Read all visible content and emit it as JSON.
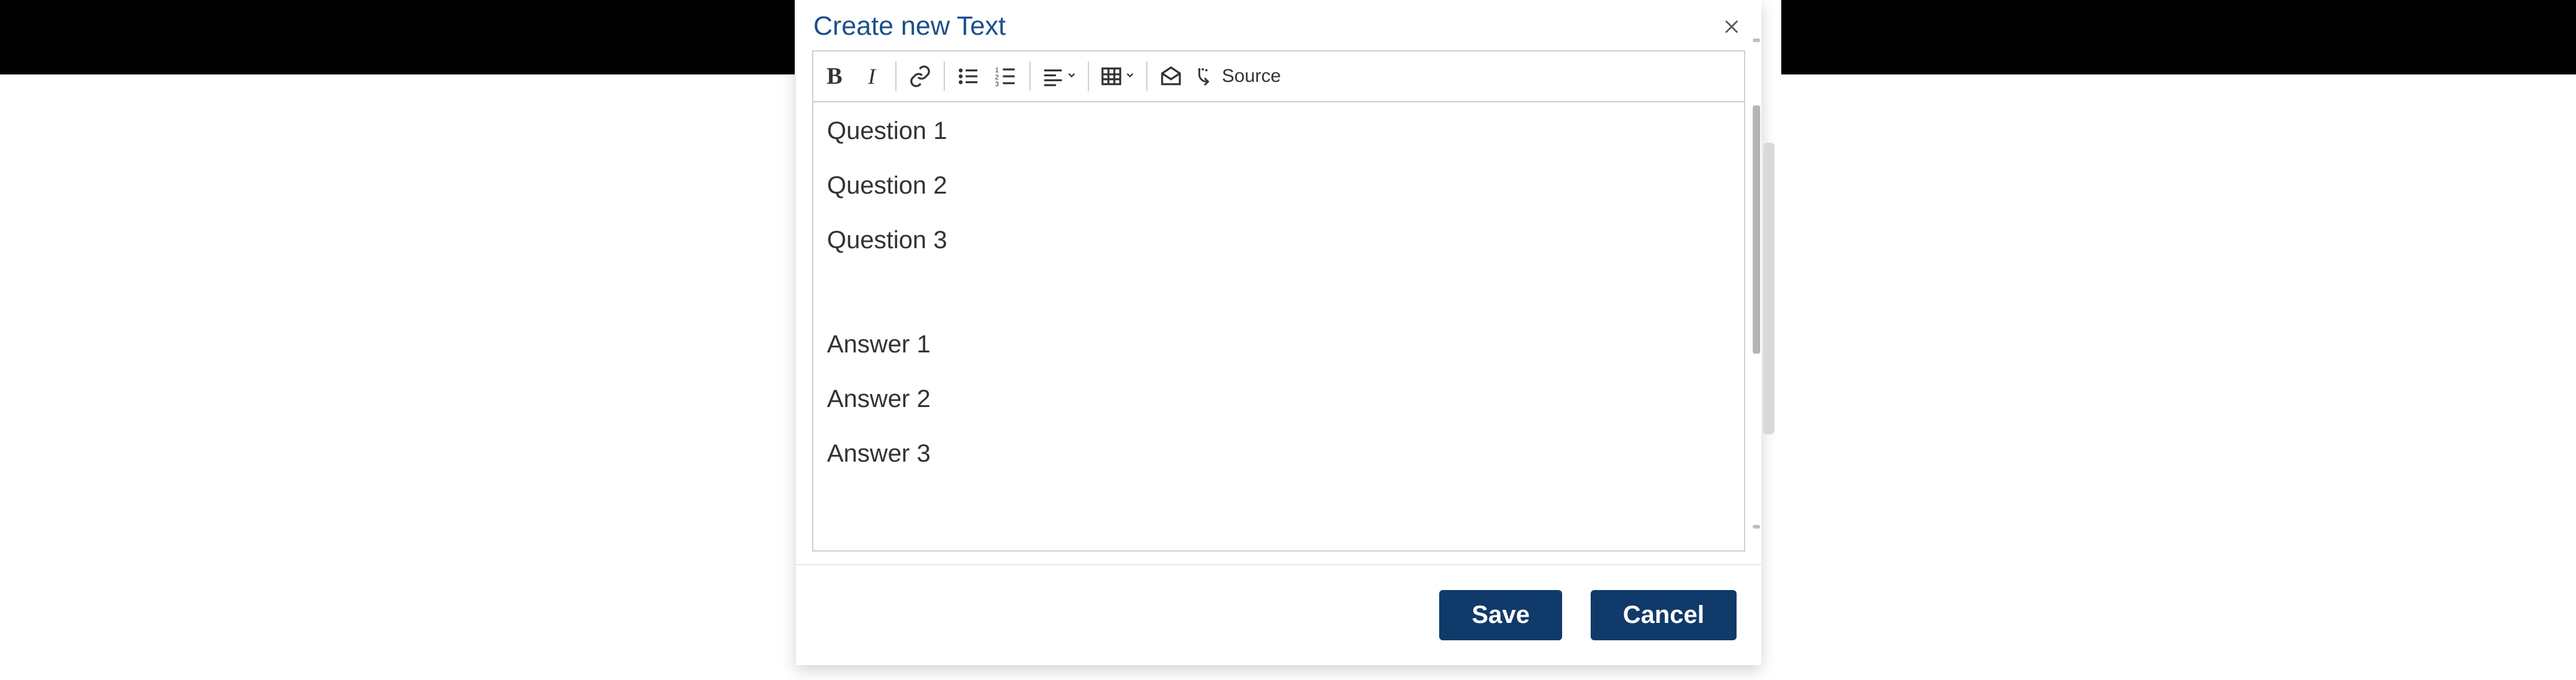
{
  "dialog": {
    "title": "Create new Text",
    "close_name": "close"
  },
  "toolbar": {
    "bold": "B",
    "italic": "I",
    "source_label": "Source"
  },
  "editor": {
    "lines": {
      "q1": "Question 1",
      "q2": "Question 2",
      "q3": "Question 3",
      "a1": "Answer 1",
      "a2": "Answer 2",
      "a3": "Answer 3"
    }
  },
  "footer": {
    "save": "Save",
    "cancel": "Cancel"
  }
}
